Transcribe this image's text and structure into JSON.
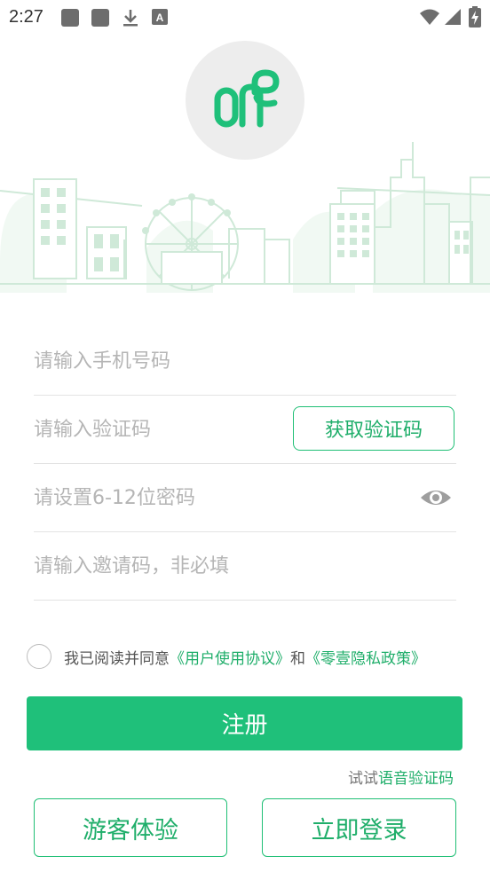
{
  "status_bar": {
    "time": "2:27",
    "icons": [
      "notification-square-icon",
      "notification-square-icon",
      "download-icon",
      "font-a-icon",
      "wifi-icon",
      "signal-icon",
      "battery-charging-icon"
    ]
  },
  "brand": {
    "logo_icon": "one-logo-icon",
    "accent_color": "#1fc07a"
  },
  "form": {
    "phone_placeholder": "请输入手机号码",
    "code_placeholder": "请输入验证码",
    "get_code_label": "获取验证码",
    "password_placeholder": "请设置6-12位密码",
    "invite_placeholder": "请输入邀请码，非必填"
  },
  "agreement": {
    "prefix": "我已阅读并同意",
    "user_agreement": "《用户使用协议》",
    "and": "和",
    "privacy_policy": "《零壹隐私政策》"
  },
  "register_label": "注册",
  "voice_code": {
    "prefix": "试试",
    "link": "语音验证码"
  },
  "guest_label": "游客体验",
  "login_label": "立即登录"
}
